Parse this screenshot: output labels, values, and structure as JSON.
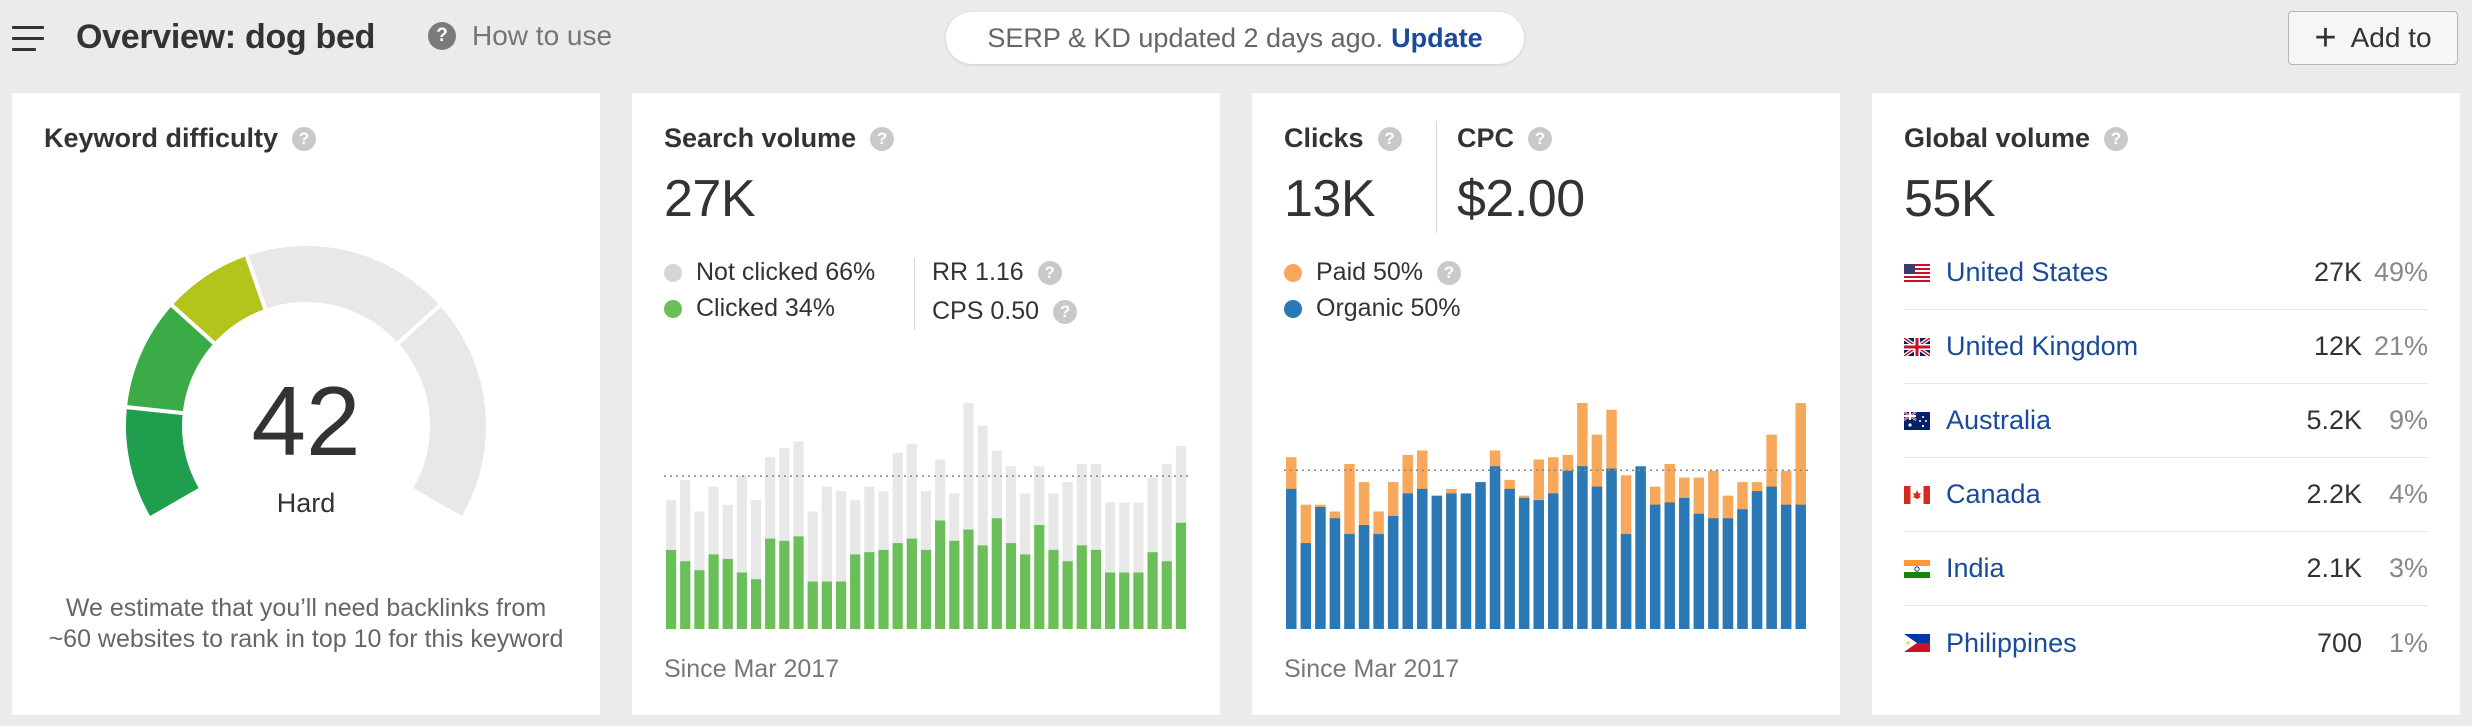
{
  "header": {
    "title": "Overview: dog bed",
    "how_to_use": "How to use",
    "serp_status": "SERP & KD updated 2 days ago.",
    "update_link": "Update",
    "add_to": "Add to",
    "help_glyph": "?",
    "plus_glyph": "+"
  },
  "kd": {
    "title": "Keyword difficulty",
    "value": "42",
    "level": "Hard",
    "description": "We estimate that you’ll need backlinks from ~60 websites to rank in top 10 for this keyword"
  },
  "search_volume": {
    "title": "Search volume",
    "value": "27K",
    "not_clicked": "Not clicked 66%",
    "clicked": "Clicked 34%",
    "rr": "RR 1.16",
    "cps": "CPS 0.50",
    "since": "Since Mar 2017",
    "colors": {
      "total": "#e8e8e8",
      "clicked": "#6bbf59"
    },
    "bars": [
      {
        "total": 0.57,
        "clicked": 0.35
      },
      {
        "total": 0.66,
        "clicked": 0.3
      },
      {
        "total": 0.52,
        "clicked": 0.26
      },
      {
        "total": 0.63,
        "clicked": 0.33
      },
      {
        "total": 0.55,
        "clicked": 0.31
      },
      {
        "total": 0.68,
        "clicked": 0.25
      },
      {
        "total": 0.57,
        "clicked": 0.22
      },
      {
        "total": 0.76,
        "clicked": 0.4
      },
      {
        "total": 0.8,
        "clicked": 0.39
      },
      {
        "total": 0.83,
        "clicked": 0.41
      },
      {
        "total": 0.52,
        "clicked": 0.21
      },
      {
        "total": 0.63,
        "clicked": 0.21
      },
      {
        "total": 0.61,
        "clicked": 0.21
      },
      {
        "total": 0.57,
        "clicked": 0.33
      },
      {
        "total": 0.63,
        "clicked": 0.34
      },
      {
        "total": 0.61,
        "clicked": 0.35
      },
      {
        "total": 0.78,
        "clicked": 0.38
      },
      {
        "total": 0.82,
        "clicked": 0.4
      },
      {
        "total": 0.61,
        "clicked": 0.35
      },
      {
        "total": 0.75,
        "clicked": 0.48
      },
      {
        "total": 0.6,
        "clicked": 0.39
      },
      {
        "total": 1.0,
        "clicked": 0.44
      },
      {
        "total": 0.9,
        "clicked": 0.37
      },
      {
        "total": 0.79,
        "clicked": 0.49
      },
      {
        "total": 0.72,
        "clicked": 0.38
      },
      {
        "total": 0.6,
        "clicked": 0.33
      },
      {
        "total": 0.72,
        "clicked": 0.46
      },
      {
        "total": 0.6,
        "clicked": 0.35
      },
      {
        "total": 0.65,
        "clicked": 0.3
      },
      {
        "total": 0.73,
        "clicked": 0.37
      },
      {
        "total": 0.73,
        "clicked": 0.35
      },
      {
        "total": 0.56,
        "clicked": 0.25
      },
      {
        "total": 0.56,
        "clicked": 0.25
      },
      {
        "total": 0.56,
        "clicked": 0.25
      },
      {
        "total": 0.67,
        "clicked": 0.34
      },
      {
        "total": 0.73,
        "clicked": 0.3
      },
      {
        "total": 0.81,
        "clicked": 0.47
      }
    ]
  },
  "clicks": {
    "title": "Clicks",
    "value": "13K",
    "paid": "Paid 50%",
    "organic": "Organic 50%",
    "since": "Since Mar 2017",
    "colors": {
      "paid": "#f7a85a",
      "organic": "#2a78b6"
    },
    "bars": [
      {
        "total": 0.76,
        "organic": 0.62
      },
      {
        "total": 0.55,
        "organic": 0.38
      },
      {
        "total": 0.55,
        "organic": 0.54
      },
      {
        "total": 0.52,
        "organic": 0.49
      },
      {
        "total": 0.73,
        "organic": 0.42
      },
      {
        "total": 0.65,
        "organic": 0.46
      },
      {
        "total": 0.52,
        "organic": 0.42
      },
      {
        "total": 0.65,
        "organic": 0.5
      },
      {
        "total": 0.77,
        "organic": 0.6
      },
      {
        "total": 0.79,
        "organic": 0.62
      },
      {
        "total": 0.58,
        "organic": 0.59
      },
      {
        "total": 0.62,
        "organic": 0.6
      },
      {
        "total": 0.58,
        "organic": 0.6
      },
      {
        "total": 0.62,
        "organic": 0.65
      },
      {
        "total": 0.79,
        "organic": 0.72
      },
      {
        "total": 0.66,
        "organic": 0.62
      },
      {
        "total": 0.59,
        "organic": 0.58
      },
      {
        "total": 0.75,
        "organic": 0.57
      },
      {
        "total": 0.76,
        "organic": 0.6
      },
      {
        "total": 0.77,
        "organic": 0.7
      },
      {
        "total": 1.0,
        "organic": 0.72
      },
      {
        "total": 0.86,
        "organic": 0.63
      },
      {
        "total": 0.97,
        "organic": 0.71
      },
      {
        "total": 0.68,
        "organic": 0.42
      },
      {
        "total": 0.71,
        "organic": 0.72
      },
      {
        "total": 0.63,
        "organic": 0.55
      },
      {
        "total": 0.73,
        "organic": 0.56
      },
      {
        "total": 0.67,
        "organic": 0.58
      },
      {
        "total": 0.67,
        "organic": 0.51
      },
      {
        "total": 0.7,
        "organic": 0.49
      },
      {
        "total": 0.59,
        "organic": 0.49
      },
      {
        "total": 0.65,
        "organic": 0.53
      },
      {
        "total": 0.65,
        "organic": 0.61
      },
      {
        "total": 0.86,
        "organic": 0.63
      },
      {
        "total": 0.7,
        "organic": 0.55
      },
      {
        "total": 1.0,
        "organic": 0.55
      }
    ]
  },
  "cpc": {
    "title": "CPC",
    "value": "$2.00"
  },
  "global_volume": {
    "title": "Global volume",
    "value": "55K",
    "countries": [
      {
        "name": "United States",
        "volume": "27K",
        "percent": "49%",
        "flag": "us-flag-icon"
      },
      {
        "name": "United Kingdom",
        "volume": "12K",
        "percent": "21%",
        "flag": "uk-flag-icon"
      },
      {
        "name": "Australia",
        "volume": "5.2K",
        "percent": "9%",
        "flag": "australia-flag-icon"
      },
      {
        "name": "Canada",
        "volume": "2.2K",
        "percent": "4%",
        "flag": "canada-flag-icon"
      },
      {
        "name": "India",
        "volume": "2.1K",
        "percent": "3%",
        "flag": "india-flag-icon"
      },
      {
        "name": "Philippines",
        "volume": "700",
        "percent": "1%",
        "flag": "philippines-flag-icon"
      }
    ]
  }
}
